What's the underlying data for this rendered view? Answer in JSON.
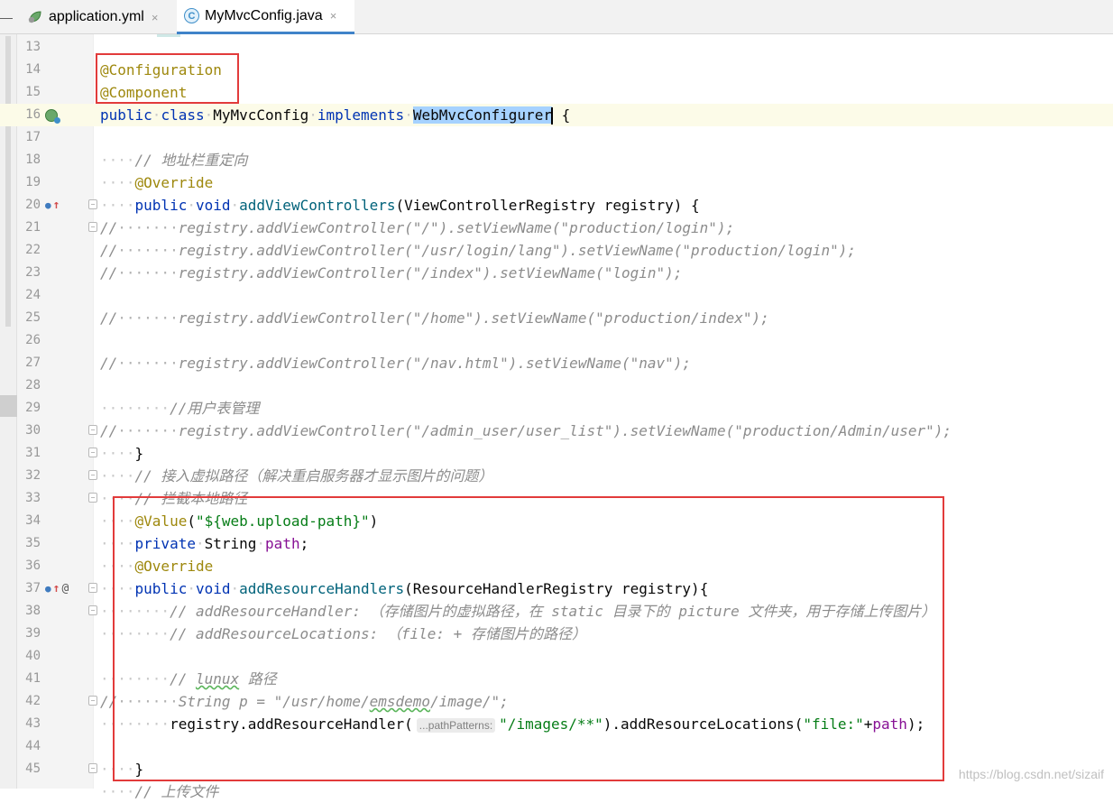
{
  "tabs": [
    {
      "label": "application.yml",
      "icon": "spring-yml-icon",
      "active": false
    },
    {
      "label": "MyMvcConfig.java",
      "icon": "java-class-icon",
      "active": true
    }
  ],
  "tab_close": "×",
  "tab_minus": "—",
  "line_numbers": [
    "13",
    "14",
    "15",
    "16",
    "17",
    "18",
    "19",
    "20",
    "21",
    "22",
    "23",
    "24",
    "25",
    "26",
    "27",
    "28",
    "29",
    "30",
    "31",
    "32",
    "33",
    "34",
    "35",
    "36",
    "37",
    "38",
    "39",
    "40",
    "41",
    "42",
    "43",
    "44",
    "45"
  ],
  "code": {
    "l14": "@Configuration",
    "l15": "@Component",
    "l16_public": "public",
    "l16_class": "class",
    "l16_name": "MyMvcConfig",
    "l16_implements": "implements",
    "l16_iface": "WebMvcConfigurer",
    "l16_brace": " {",
    "l18": "// 地址栏重定向",
    "l19": "@Override",
    "l20_public": "public",
    "l20_void": "void",
    "l20_method": "addViewControllers",
    "l20_params": "(ViewControllerRegistry registry) {",
    "l21_a": "registry.addViewController(\"/\").setViewName(\"production/login\");",
    "l22_a": "registry.addViewController(\"/usr/login/lang\").setViewName(\"production/login\");",
    "l23_a": "registry.addViewController(\"/index\").setViewName(\"login\");",
    "l25_a": "registry.addViewController(\"/home\").setViewName(\"production/index\");",
    "l27_a": "registry.addViewController(\"/nav.html\").setViewName(\"nav\");",
    "l29": "//用户表管理",
    "l30_a": "registry.addViewController(\"/admin_user/user_list\").setViewName(\"production/Admin/user\");",
    "comment_prefix": "//",
    "l31": "}",
    "l32": "// 接入虚拟路径（解决重启服务器才显示图片的问题）",
    "l33": "// 拦截本地路径",
    "l34_ann": "@Value",
    "l34_paren_open": "(",
    "l34_str": "\"${web.upload-path}\"",
    "l34_paren_close": ")",
    "l35_private": "private",
    "l35_type": "String",
    "l35_field": "path",
    "l35_semi": ";",
    "l36": "@Override",
    "l37_public": "public",
    "l37_void": "void",
    "l37_method": "addResourceHandlers",
    "l37_params": "(ResourceHandlerRegistry registry){",
    "l38": "// addResourceHandler: （存储图片的虚拟路径，在 static 目录下的 picture 文件夹，用于存储上传图片）",
    "l39": "// addResourceLocations: （file: + 存储图片的路径）",
    "l41_a": "// ",
    "l41_word": "lunux",
    "l41_b": " 路径",
    "l42_a": "String p = \"/usr/home/",
    "l42_word": "emsdemo",
    "l42_b": "/image/\";",
    "l43_a": "registry.addResourceHandler(",
    "l43_hint": "...pathPatterns:",
    "l43_str1": "\"/images/**\"",
    "l43_b": ").addResourceLocations(",
    "l43_str2": "\"file:\"",
    "l43_plus": "+",
    "l43_field": "path",
    "l43_end": ");",
    "l45": "}",
    "l46": "// 上传文件"
  },
  "watermark": "https://blog.csdn.net/sizaif",
  "annotation_color": "#e23b3b"
}
